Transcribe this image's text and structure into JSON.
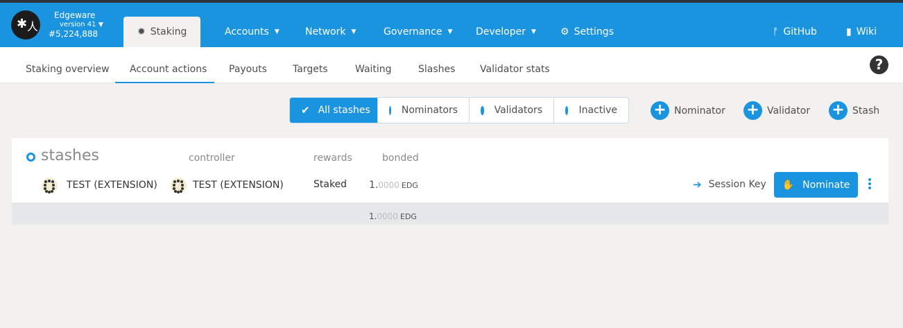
{
  "app": {
    "chain_name": "Edgeware",
    "version": "version 41",
    "block": "#5,224,888",
    "logo": "edgeware-logo"
  },
  "topnav": {
    "staking": "Staking",
    "accounts": "Accounts",
    "network": "Network",
    "governance": "Governance",
    "developer": "Developer",
    "settings": "Settings",
    "github": "GitHub",
    "wiki": "Wiki"
  },
  "subnav": {
    "tabs": [
      "Staking overview",
      "Account actions",
      "Payouts",
      "Targets",
      "Waiting",
      "Slashes",
      "Validator stats"
    ],
    "active": "Account actions",
    "help_glyph": "?"
  },
  "filters": {
    "items": [
      "All stashes",
      "Nominators",
      "Validators",
      "Inactive"
    ],
    "active": "All stashes"
  },
  "actions": {
    "nominator": "Nominator",
    "validator": "Validator",
    "stash": "Stash"
  },
  "table": {
    "title": "stashes",
    "headers": {
      "controller": "controller",
      "rewards": "rewards",
      "bonded": "bonded"
    },
    "rows": [
      {
        "stash": "TEST (EXTENSION)",
        "controller": "TEST (EXTENSION)",
        "rewards": "Staked",
        "bonded_int": "1.",
        "bonded_dec": "0000",
        "bonded_unit": "EDG",
        "session_key": "Session Key",
        "nominate": "Nominate"
      }
    ],
    "total": {
      "int": "1.",
      "dec": "0000",
      "unit": "EDG"
    }
  },
  "colors": {
    "brand": "#1b94e0",
    "topstrip": "#2e3339",
    "background": "#f2f1f0"
  }
}
